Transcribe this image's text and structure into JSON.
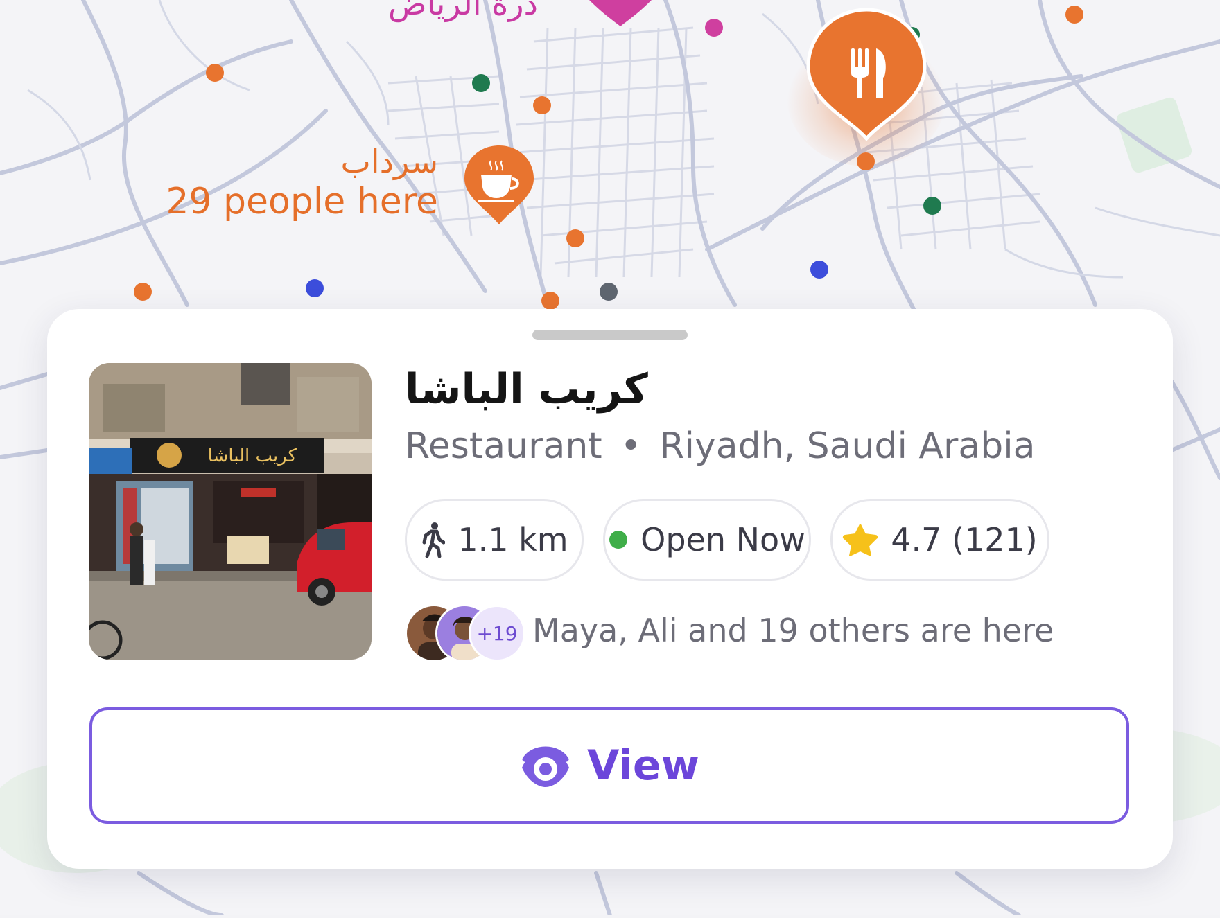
{
  "map": {
    "top_place_label": "درة الرياض",
    "featured_place": {
      "name": "سرداب",
      "people_text": "29 people here",
      "icon": "coffee-cup-icon",
      "color": "#e56f2a"
    },
    "selected_place_icon": "fork-knife-icon",
    "colors": {
      "orange": "#e8742f",
      "green": "#1f7a4f",
      "blue": "#3c4ddb",
      "magenta": "#cf3f9f",
      "gray": "#5f6670"
    }
  },
  "card": {
    "title": "كريب الباشا",
    "category": "Restaurant",
    "separator": "•",
    "location": "Riyadh, Saudi Arabia",
    "photo_sign_text": "كريب الباشا",
    "chips": {
      "distance": {
        "icon": "walking-person-icon",
        "label": "1.1 km"
      },
      "status": {
        "icon": "status-dot-icon",
        "label": "Open Now",
        "color": "#3fae49"
      },
      "rating": {
        "icon": "star-icon",
        "label": "4.7 (121)",
        "color": "#f6c11a"
      }
    },
    "people": {
      "more_count": "+19",
      "text": "Maya, Ali and 19 others are here"
    },
    "view_button": {
      "icon": "eye-icon",
      "label": "View"
    },
    "accent": "#7b5ce0"
  }
}
